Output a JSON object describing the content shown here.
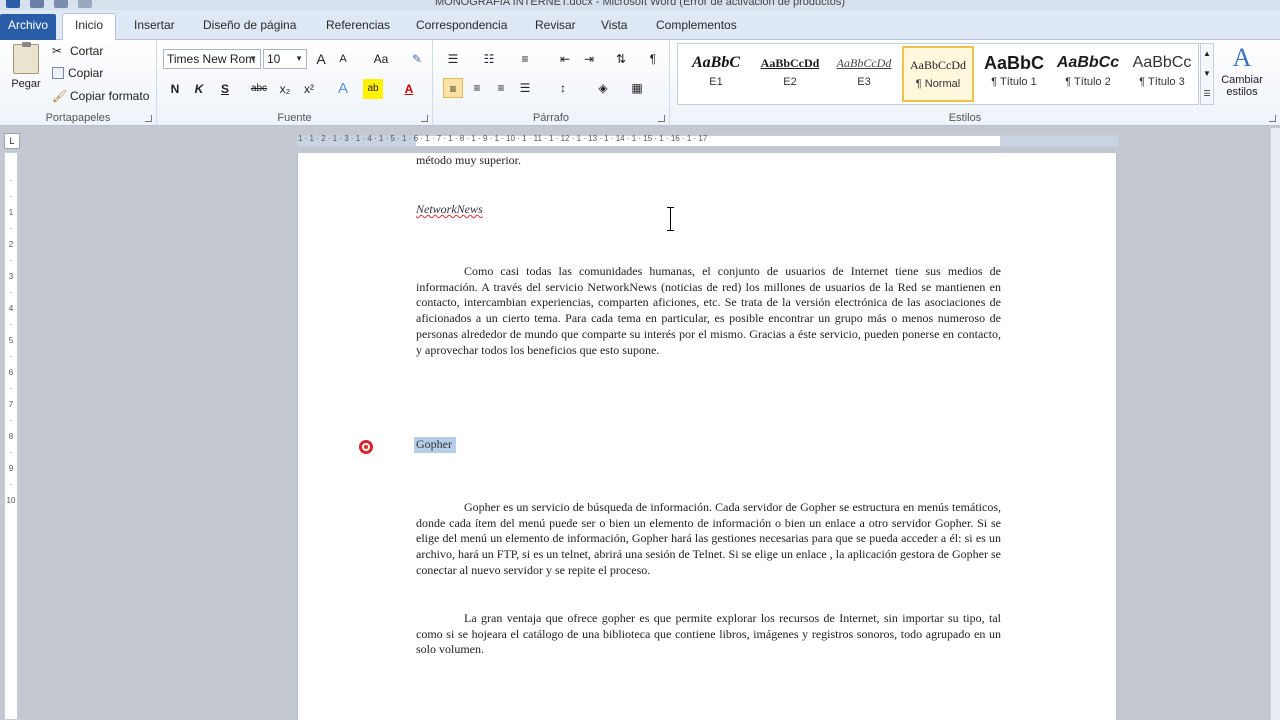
{
  "window": {
    "title": "MONOGRAFIA INTERNET.docx - Microsoft Word (Error de activación de productos)"
  },
  "tabs": [
    {
      "label": "Archivo"
    },
    {
      "label": "Inicio"
    },
    {
      "label": "Insertar"
    },
    {
      "label": "Diseño de página"
    },
    {
      "label": "Referencias"
    },
    {
      "label": "Correspondencia"
    },
    {
      "label": "Revisar"
    },
    {
      "label": "Vista"
    },
    {
      "label": "Complementos"
    }
  ],
  "ribbon": {
    "clipboard": {
      "paste": "Pegar",
      "cut": "Cortar",
      "copy": "Copiar",
      "format_painter": "Copiar formato",
      "group_label": "Portapapeles"
    },
    "font": {
      "family": "Times New Rom",
      "size": "10",
      "grow": "A",
      "shrink": "A",
      "case": "Aa",
      "bold": "N",
      "italic": "K",
      "underline": "S",
      "strike": "abc",
      "subscript": "x₂",
      "superscript": "x²",
      "group_label": "Fuente"
    },
    "paragraph": {
      "group_label": "Párrafo"
    },
    "styles": {
      "items": [
        {
          "sample": "AaBbC",
          "name": "E1"
        },
        {
          "sample": "AaBbCcDd",
          "name": "E2"
        },
        {
          "sample": "AaBbCcDd",
          "name": "E3"
        },
        {
          "sample": "AaBbCcDd",
          "name": "¶ Normal"
        },
        {
          "sample": "AaBbC",
          "name": "¶ Título 1"
        },
        {
          "sample": "AaBbCc",
          "name": "¶ Título 2"
        },
        {
          "sample": "AaBbCc",
          "name": "¶ Título 3"
        }
      ],
      "change_styles": "Cambiar estilos",
      "group_label": "Estilos"
    }
  },
  "ruler": {
    "numbers": "1 · 1 · 2 · 1 · 3 · 1 · 4 · 1 · 5 · 1 · 6 · 1 · 7 · 1 · 8 · 1 · 9 · 1 · 10 · 1 · 11 · 1 · 12 · 1 · 13 · 1 · 14 · 1 · 15 · 1 · 16 · 1 · 17"
  },
  "document": {
    "prev_line": "método muy superior.",
    "heading1": "NetworkNews",
    "para1": "Como casi todas las comunidades humanas, el conjunto de usuarios de Internet tiene sus medios de información. A través del servicio NetworkNews (noticias de red) los millones de usuarios de la Red se mantienen en contacto, intercambian experiencias, comparten aficiones, etc. Se trata de la versión electrónica de las asociaciones de aficionados a un cierto tema. Para cada tema en particular, es posible encontrar un grupo más o menos numeroso de personas alrededor de mundo que comparte su interés por el mismo. Gracias a éste servicio, pueden ponerse en contacto, y aprovechar todos los beneficios que esto supone.",
    "heading2": "Gopher",
    "para2": "Gopher es un servicio de búsqueda de información. Cada servidor de Gopher se estructura en menús temáticos, donde cada ítem del menú puede ser o bien un elemento de información o bien un enlace a otro servidor Gopher. Si se elige del menú un elemento de información, Gopher hará las gestiones necesarias para que se pueda acceder a él: si es un archivo, hará un FTP, si es un telnet, abrirá una sesión de Telnet. Si se elige un enlace , la aplicación gestora de Gopher se conectar al nuevo servidor y se repite el proceso.",
    "para3": "La gran ventaja que ofrece gopher es que permite explorar los recursos de Internet, sin importar su tipo, tal como si se hojeara el catálogo de una biblioteca que contiene libros, imágenes y registros sonoros, todo agrupado en un solo volumen."
  },
  "colors": {
    "file_tab": "#2a5da8",
    "selection": "#b5cde8",
    "highlight_button": "#fce2a4",
    "revision_mark": "#d9252b"
  }
}
